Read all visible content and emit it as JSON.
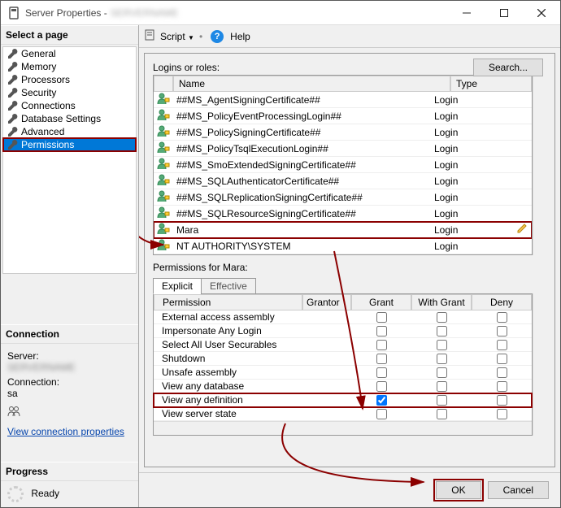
{
  "window": {
    "title_prefix": "Server Properties -",
    "title_blur": "SERVERNAME"
  },
  "toolbar": {
    "script_label": "Script",
    "help_label": "Help"
  },
  "left": {
    "select_page": "Select a page",
    "pages": [
      "General",
      "Memory",
      "Processors",
      "Security",
      "Connections",
      "Database Settings",
      "Advanced",
      "Permissions"
    ],
    "selected_index": 7,
    "connection_hdr": "Connection",
    "server_label": "Server:",
    "server_value_blur": "SERVERNAME",
    "connection_label": "Connection:",
    "connection_value": "sa",
    "view_conn_props": "View connection properties",
    "progress_hdr": "Progress",
    "progress_state": "Ready"
  },
  "main": {
    "logins_label": "Logins or roles:",
    "search_btn": "Search...",
    "grid_headers": {
      "name": "Name",
      "type": "Type"
    },
    "logins": [
      {
        "name": "##MS_AgentSigningCertificate##",
        "type": "Login"
      },
      {
        "name": "##MS_PolicyEventProcessingLogin##",
        "type": "Login"
      },
      {
        "name": "##MS_PolicySigningCertificate##",
        "type": "Login"
      },
      {
        "name": "##MS_PolicyTsqlExecutionLogin##",
        "type": "Login"
      },
      {
        "name": "##MS_SmoExtendedSigningCertificate##",
        "type": "Login"
      },
      {
        "name": "##MS_SQLAuthenticatorCertificate##",
        "type": "Login"
      },
      {
        "name": "##MS_SQLReplicationSigningCertificate##",
        "type": "Login"
      },
      {
        "name": "##MS_SQLResourceSigningCertificate##",
        "type": "Login"
      },
      {
        "name": "Mara",
        "type": "Login",
        "highlight": true,
        "editable": true
      },
      {
        "name": "NT AUTHORITY\\SYSTEM",
        "type": "Login"
      }
    ],
    "perms_for": "Permissions for Mara:",
    "tabs": [
      "Explicit",
      "Effective"
    ],
    "perm_headers": {
      "permission": "Permission",
      "grantor": "Grantor",
      "grant": "Grant",
      "withgrant": "With Grant",
      "deny": "Deny"
    },
    "permissions": [
      {
        "name": "External access assembly",
        "grant": false,
        "withgrant": false,
        "deny": false
      },
      {
        "name": "Impersonate Any Login",
        "grant": false,
        "withgrant": false,
        "deny": false
      },
      {
        "name": "Select All User Securables",
        "grant": false,
        "withgrant": false,
        "deny": false
      },
      {
        "name": "Shutdown",
        "grant": false,
        "withgrant": false,
        "deny": false
      },
      {
        "name": "Unsafe assembly",
        "grant": false,
        "withgrant": false,
        "deny": false
      },
      {
        "name": "View any database",
        "grant": false,
        "withgrant": false,
        "deny": false
      },
      {
        "name": "View any definition",
        "grant": true,
        "withgrant": false,
        "deny": false,
        "highlight": true
      },
      {
        "name": "View server state",
        "grant": false,
        "withgrant": false,
        "deny": false
      }
    ]
  },
  "buttons": {
    "ok": "OK",
    "cancel": "Cancel"
  }
}
